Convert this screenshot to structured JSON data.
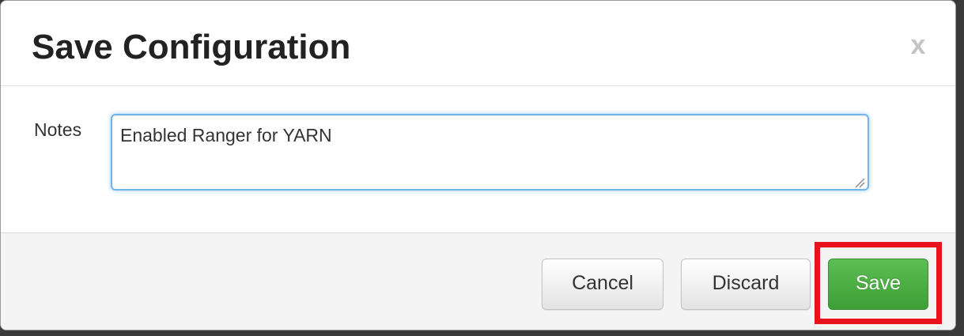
{
  "dialog": {
    "title": "Save Configuration",
    "close_label": "x"
  },
  "notes": {
    "label": "Notes",
    "value": "Enabled Ranger for YARN"
  },
  "footer": {
    "cancel_label": "Cancel",
    "discard_label": "Discard",
    "save_label": "Save"
  },
  "colors": {
    "save_button": "#45a43e",
    "highlight_outline": "#e8121c",
    "input_focus_border": "#71b4ec"
  },
  "icons": {
    "close": "close-icon",
    "resize": "resize-grip-icon"
  }
}
